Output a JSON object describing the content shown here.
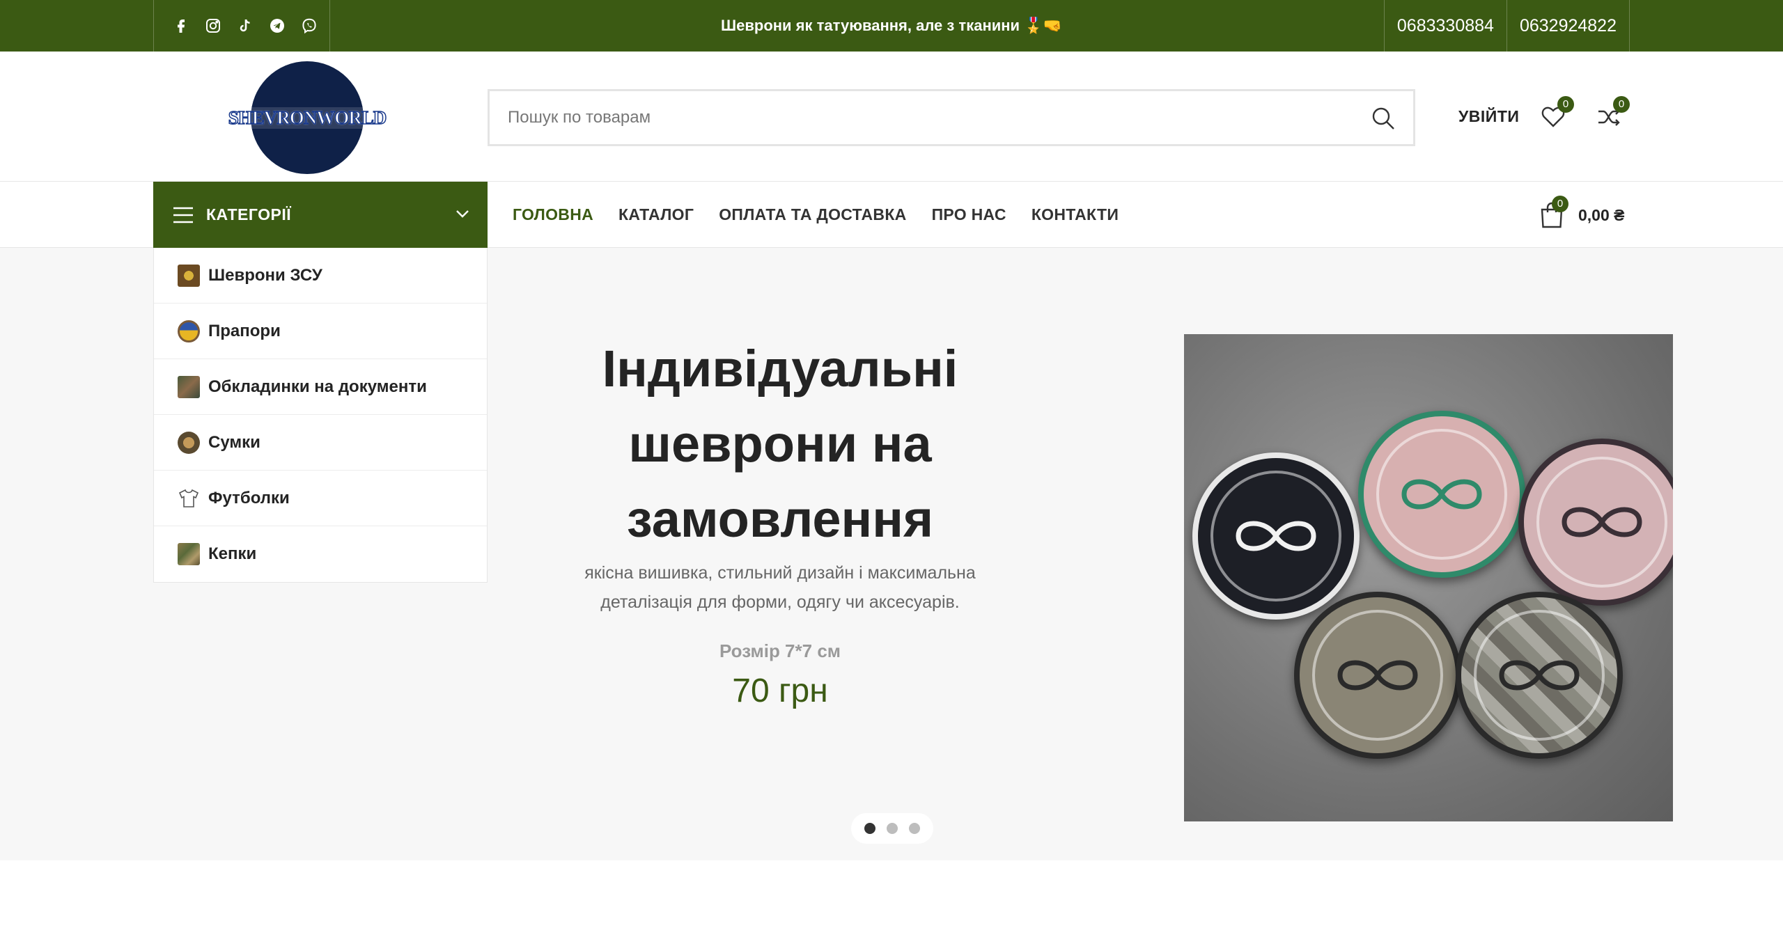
{
  "topbar": {
    "promo": "Шеврони як татуювання, але з тканини 🎖️🤜",
    "phones": [
      "0683330884",
      "0632924822"
    ],
    "social_icons": [
      "facebook-icon",
      "instagram-icon",
      "tiktok-icon",
      "telegram-icon",
      "viber-icon"
    ]
  },
  "header": {
    "logo_text": "SHEVRONWORLD",
    "search_placeholder": "Пошук по товарам",
    "login_label": "УВІЙТИ",
    "wishlist_count": "0",
    "compare_count": "0"
  },
  "nav": {
    "categories_label": "КАТЕГОРІЇ",
    "menu": [
      {
        "label": "ГОЛОВНА",
        "active": true
      },
      {
        "label": "КАТАЛОГ",
        "active": false
      },
      {
        "label": "ОПЛАТА ТА ДОСТАВКА",
        "active": false
      },
      {
        "label": "ПРО НАС",
        "active": false
      },
      {
        "label": "КОНТАКТИ",
        "active": false
      }
    ],
    "cart_count": "0",
    "cart_total": "0,00 ₴"
  },
  "categories": [
    {
      "label": "Шеврони ЗСУ"
    },
    {
      "label": "Прапори"
    },
    {
      "label": "Обкладинки на документи"
    },
    {
      "label": "Сумки"
    },
    {
      "label": "Футболки"
    },
    {
      "label": "Кепки"
    }
  ],
  "slide": {
    "title_lines": [
      "Індивідуальні",
      "шеврони на",
      "замовлення"
    ],
    "subtitle_lines": [
      "якісна вишивка, стильний дизайн і максимальна",
      "деталізація для форми, одягу чи аксесуарів."
    ],
    "size": "Розмір 7*7 см",
    "price": "70 грн",
    "active_dot": 1,
    "dot_count": 3
  },
  "colors": {
    "brand_green": "#3b5a13",
    "text_dark": "#242424",
    "hero_bg": "#f7f7f7"
  }
}
